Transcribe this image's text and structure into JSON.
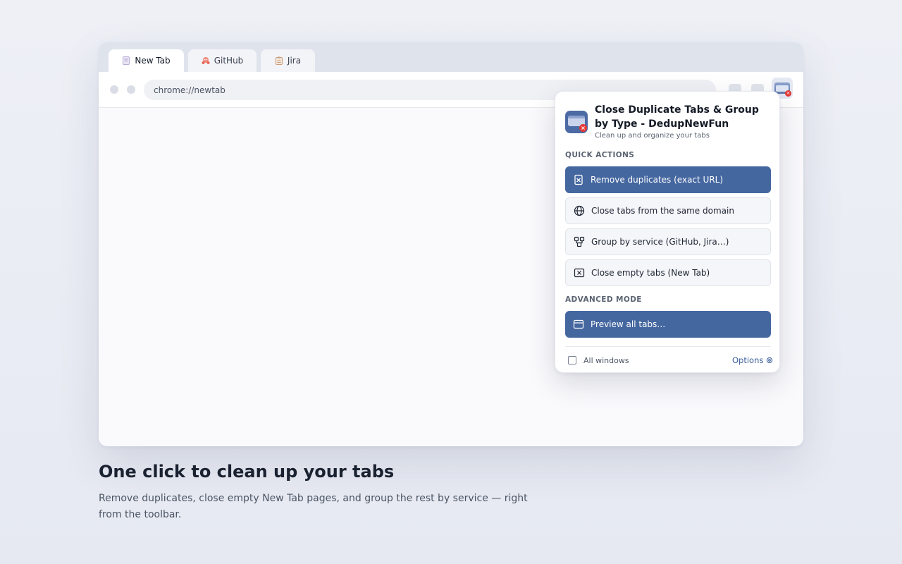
{
  "browser": {
    "tabs": [
      {
        "label": "New Tab",
        "icon": "page-icon"
      },
      {
        "label": "GitHub",
        "icon": "github-octocat-icon"
      },
      {
        "label": "Jira",
        "icon": "clipboard-icon"
      }
    ],
    "address": "chrome://newtab"
  },
  "popup": {
    "title": "Close Duplicate Tabs & Group by Type - DedupNewFun",
    "subtitle": "Clean up and organize your tabs",
    "quick_actions_heading": "QUICK ACTIONS",
    "actions": [
      {
        "label": "Remove duplicates (exact URL)",
        "icon": "duplicate-doc-icon",
        "style": "primary"
      },
      {
        "label": "Close tabs from the same domain",
        "icon": "globe-icon",
        "style": "secondary"
      },
      {
        "label": "Group by service (GitHub, Jira…)",
        "icon": "group-icon",
        "style": "secondary"
      },
      {
        "label": "Close empty tabs (New Tab)",
        "icon": "close-box-icon",
        "style": "secondary"
      }
    ],
    "advanced_heading": "ADVANCED MODE",
    "preview_label": "Preview all tabs…",
    "all_windows_label": "All windows",
    "all_windows_checked": false,
    "options_label": "Options",
    "accent_color": "#4567a0"
  },
  "marketing": {
    "headline": "One click to clean up your tabs",
    "description": "Remove duplicates, close empty New Tab pages, and group the rest by service — right from the toolbar."
  }
}
